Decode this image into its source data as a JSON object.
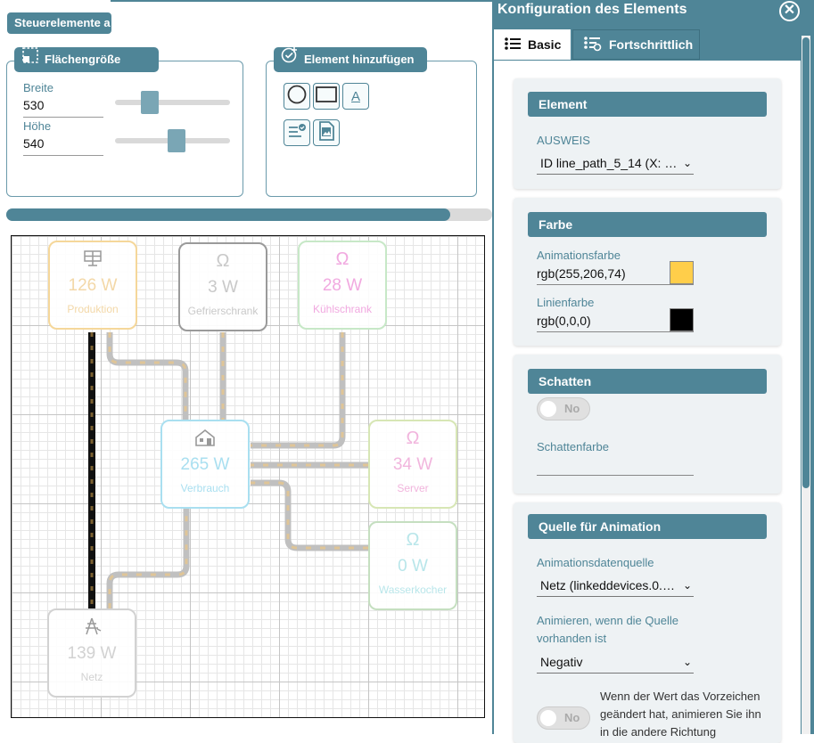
{
  "controls": {
    "header_chip": "Steuerelemente a",
    "flaeche": {
      "title": "Flächengröße",
      "width_label": "Breite",
      "width_value": "530",
      "height_label": "Höhe",
      "height_value": "540"
    },
    "element_add": {
      "title": "Element hinzufügen",
      "text_icon_glyph": "A"
    }
  },
  "canvas": {
    "devices": [
      {
        "key": "produktion",
        "icon": "solar-panel-icon",
        "value": "126 W",
        "name": "Produktion",
        "color": "#f5d79a",
        "text_color": "#f3d8a8"
      },
      {
        "key": "gefrierschrank",
        "icon": "socket-icon",
        "value": "3 W",
        "name": "Gefrierschrank",
        "color": "#9a9a9a",
        "text_color": "#c9c9c9"
      },
      {
        "key": "kuehlschrank",
        "icon": "socket-icon",
        "value": "28 W",
        "name": "Kühlschrank",
        "color": "#c7e8c7",
        "text_color": "#f1a9e0"
      },
      {
        "key": "verbrauch",
        "icon": "house-icon",
        "value": "265 W",
        "name": "Verbrauch",
        "color": "#a9dff0",
        "text_color": "#a9dff0"
      },
      {
        "key": "server",
        "icon": "socket-icon",
        "value": "34 W",
        "name": "Server",
        "color": "#d7e6b5",
        "text_color": "#f1b5dd"
      },
      {
        "key": "wasserkocher",
        "icon": "socket-icon",
        "value": "0 W",
        "name": "Wasserkocher",
        "color": "#c5dfc0",
        "text_color": "#b9e6ea"
      },
      {
        "key": "netz",
        "icon": "power-pylon-icon",
        "value": "139 W",
        "name": "Netz",
        "color": "#d2d2d2",
        "text_color": "#d2d2d2"
      }
    ],
    "colors": {
      "line_idle": "#c0c0c0",
      "animation": "rgb(255,206,74)",
      "selected_line": "#000000"
    }
  },
  "config": {
    "title": "Konfiguration des Elements",
    "close_glyph": "✕",
    "tabs": [
      {
        "label": "Basic",
        "active": true
      },
      {
        "label": "Fortschrittlich",
        "active": false
      }
    ],
    "element_card": {
      "header": "Element",
      "field_label": "AUSWEIS",
      "field_value": "ID line_path_5_14 (X: …"
    },
    "color_card": {
      "header": "Farbe",
      "anim_label": "Animationsfarbe",
      "anim_value": "rgb(255,206,74)",
      "anim_swatch": "#ffce4a",
      "line_label": "Linienfarbe",
      "line_value": "rgb(0,0,0)",
      "line_swatch": "#000000"
    },
    "shadow_card": {
      "header": "Schatten",
      "toggle_text": "No",
      "toggle_on": false,
      "color_label": "Schattenfarbe",
      "color_value": ""
    },
    "source_card": {
      "header": "Quelle für Animation",
      "source_label": "Animationsdatenquelle",
      "source_value": "Netz (linkeddevices.0.…",
      "animate_label_1": "Animieren, wenn die Quelle",
      "animate_label_2": "vorhanden ist",
      "animate_value": "Negativ",
      "toggle_text": "No",
      "toggle_on": false,
      "reverse_1": "Wenn der Wert das Vorzeichen",
      "reverse_2": "geändert hat, animieren Sie ihn",
      "reverse_3": "in die andere Richtung"
    }
  }
}
